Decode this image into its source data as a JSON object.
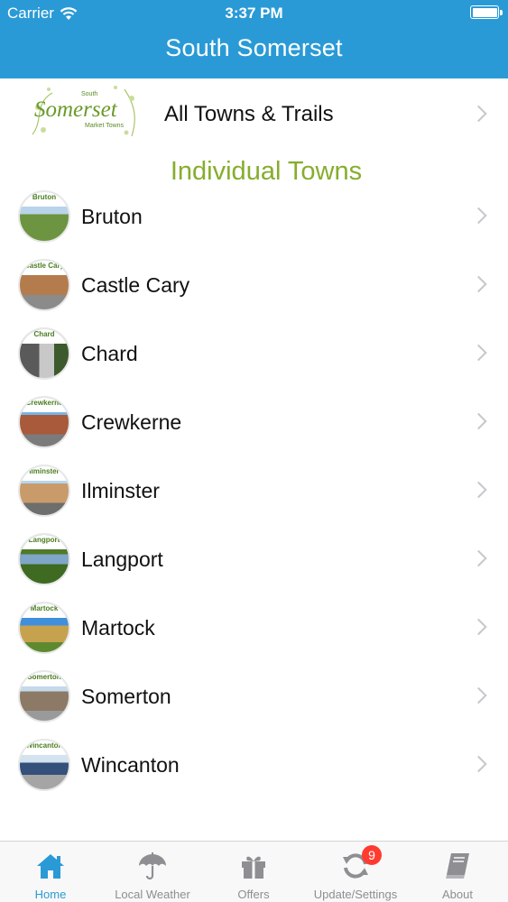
{
  "status_bar": {
    "carrier": "Carrier",
    "time": "3:37 PM"
  },
  "nav": {
    "title": "South Somerset"
  },
  "logo": {
    "line1": "South",
    "line2": "Somerset",
    "line3": "Market Towns"
  },
  "all_towns": {
    "label": "All Towns & Trails"
  },
  "section": {
    "title": "Individual Towns"
  },
  "towns": [
    {
      "name": "Bruton",
      "badge": "Bruton"
    },
    {
      "name": "Castle Cary",
      "badge": "Castle Cary"
    },
    {
      "name": "Chard",
      "badge": "Chard"
    },
    {
      "name": "Crewkerne",
      "badge": "Crewkerne"
    },
    {
      "name": "Ilminster",
      "badge": "Ilminster"
    },
    {
      "name": "Langport",
      "badge": "Langport"
    },
    {
      "name": "Martock",
      "badge": "Martock"
    },
    {
      "name": "Somerton",
      "badge": "Somerton"
    },
    {
      "name": "Wincanton",
      "badge": "Wincanton"
    }
  ],
  "tabs": [
    {
      "label": "Home",
      "icon": "home-icon",
      "active": true
    },
    {
      "label": "Local Weather",
      "icon": "umbrella-icon"
    },
    {
      "label": "Offers",
      "icon": "gift-icon"
    },
    {
      "label": "Update/Settings",
      "icon": "refresh-icon",
      "badge": "9"
    },
    {
      "label": "About",
      "icon": "book-icon"
    }
  ],
  "colors": {
    "accent": "#2a9ad6",
    "section_green": "#86ad2d",
    "inactive": "#8e8e93"
  }
}
